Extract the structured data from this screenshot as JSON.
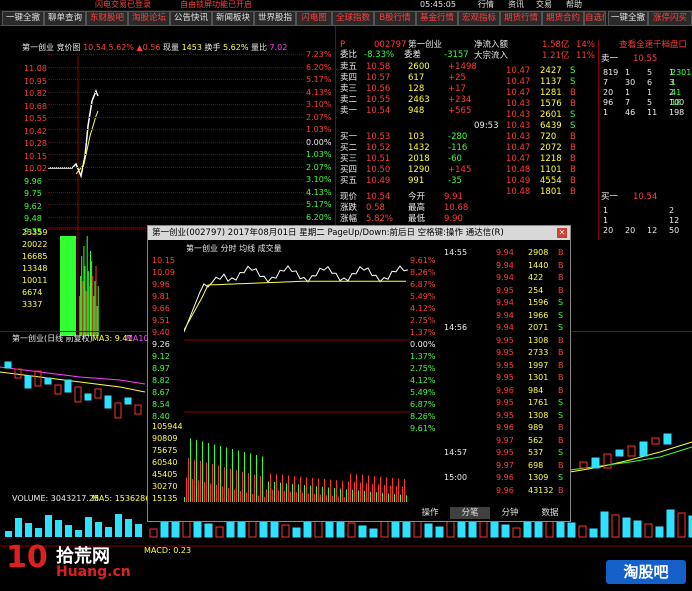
{
  "topbar": {
    "left_text": "闪电交易已登录",
    "right_text": "自由锁屏功能已开启",
    "right_menu": [
      "05:45:05",
      "行情",
      "资讯",
      "交易",
      "帮助"
    ]
  },
  "toolbar": {
    "buttons": [
      "一键全撤",
      "聊单查询",
      "东财股吧",
      "淘股论坛",
      "公告快讯",
      "新闻板块",
      "世界股指",
      "闪电图",
      "全球指数",
      "B股行情",
      "基金行情",
      "宏观指标",
      "期货行情",
      "期货合约",
      "自选信息"
    ],
    "right_buttons": [
      "一键全撤",
      "涨停闪买"
    ]
  },
  "left_panel": {
    "header": {
      "name": "第一创业",
      "mode": "竞价图",
      "price": "10.54",
      "pct": "5.62%",
      "change": "▲0.56",
      "vol_label": "现量",
      "vol": "1453",
      "turnover_label": "换手",
      "turnover": "5.62%",
      "ratio_label": "量比",
      "ratio": "7.02"
    },
    "y_left": [
      "11.08",
      "10.95",
      "10.82",
      "10.68",
      "10.55",
      "10.42",
      "10.28",
      "10.15",
      "10.02",
      "9.96",
      "9.75",
      "9.62",
      "9.48",
      "9.35"
    ],
    "y_right": [
      "7.23%",
      "6.20%",
      "5.17%",
      "4.13%",
      "3.10%",
      "2.07%",
      "1.03%",
      "0.00%",
      "1.03%",
      "2.07%",
      "3.10%",
      "4.13%",
      "5.17%",
      "6.20%",
      "7.23%"
    ],
    "vol_axis": [
      "23359",
      "20022",
      "16685",
      "13348",
      "10011",
      "6674",
      "3337"
    ]
  },
  "kline": {
    "header": "第一创业(日线 前复权)",
    "ma3": "MA3: 9.41",
    "ma10": "MA10",
    "volume": "VOLUME: 3043217.25",
    "ma5": "MA5: 1536286.38",
    "macd": "MACD: 0.23"
  },
  "quote": {
    "code": "002797",
    "name": "第一创业",
    "wei_bi_label": "委比",
    "wei_bi": "-8.33%",
    "wei_cha_label": "委差",
    "wei_cha": "-3157",
    "sell": [
      {
        "label": "卖五",
        "price": "10.58",
        "vol": "2600",
        "chg": "+1498"
      },
      {
        "label": "卖四",
        "price": "10.57",
        "vol": "617",
        "chg": "+25"
      },
      {
        "label": "卖三",
        "price": "10.56",
        "vol": "128",
        "chg": "+17"
      },
      {
        "label": "卖二",
        "price": "10.55",
        "vol": "2463",
        "chg": "+234"
      },
      {
        "label": "卖一",
        "price": "10.54",
        "vol": "948",
        "chg": "+565"
      }
    ],
    "buy": [
      {
        "label": "买一",
        "price": "10.53",
        "vol": "103",
        "chg": "-280"
      },
      {
        "label": "买二",
        "price": "10.52",
        "vol": "1432",
        "chg": "-116"
      },
      {
        "label": "买三",
        "price": "10.51",
        "vol": "2018",
        "chg": "-60"
      },
      {
        "label": "买四",
        "price": "10.50",
        "vol": "1290",
        "chg": "+145"
      },
      {
        "label": "买五",
        "price": "10.49",
        "vol": "991",
        "chg": "-35"
      }
    ],
    "stats": [
      {
        "l1": "现价",
        "v1": "10.54",
        "l2": "今开",
        "v2": "9.91"
      },
      {
        "l1": "涨跌",
        "v1": "0.58",
        "l2": "最高",
        "v2": "10.68"
      },
      {
        "l1": "涨幅",
        "v1": "5.82%",
        "l2": "最低",
        "v2": "9.90"
      }
    ]
  },
  "flow": {
    "inflow_label": "净流入额",
    "inflow": "1.58亿",
    "inflow_pct": "14%",
    "big_label": "大宗流入",
    "big": "1.21亿",
    "big_pct": "11%"
  },
  "ticks": [
    {
      "t": "",
      "p": "10.47",
      "v": "2427",
      "s": "S"
    },
    {
      "t": "",
      "p": "10.47",
      "v": "1137",
      "s": "S"
    },
    {
      "t": "",
      "p": "10.47",
      "v": "1281",
      "s": "B"
    },
    {
      "t": "",
      "p": "10.43",
      "v": "1576",
      "s": "B"
    },
    {
      "t": "",
      "p": "10.43",
      "v": "2601",
      "s": "S"
    },
    {
      "t": "09:53",
      "p": "10.43",
      "v": "6439",
      "s": "S"
    },
    {
      "t": "",
      "p": "10.43",
      "v": "720",
      "s": "B"
    },
    {
      "t": "",
      "p": "10.47",
      "v": "2072",
      "s": "B"
    },
    {
      "t": "",
      "p": "10.47",
      "v": "1218",
      "s": "B"
    },
    {
      "t": "",
      "p": "10.48",
      "v": "1101",
      "s": "B"
    },
    {
      "t": "",
      "p": "10.49",
      "v": "4554",
      "s": "B"
    },
    {
      "t": "",
      "p": "10.48",
      "v": "1801",
      "s": "B"
    }
  ],
  "far_right": {
    "button": "查看全速千档盘口",
    "sell1_label": "卖一",
    "sell1_price": "10.55",
    "sell_rows": [
      [
        "819",
        "1",
        "5",
        "1"
      ],
      [
        "7",
        "30",
        "6",
        "3"
      ],
      [
        "20",
        "1",
        "1",
        "2"
      ],
      [
        "96",
        "7",
        "5",
        "100"
      ],
      [
        "1",
        "46",
        "11",
        "198"
      ]
    ],
    "sell_extra": [
      "2301",
      "1",
      "41",
      "18"
    ],
    "buy1_label": "买一",
    "buy1_price": "10.54",
    "buy_rows": [
      [
        "1",
        "",
        "",
        "2"
      ],
      [
        "1",
        "",
        "",
        "12"
      ],
      [
        "20",
        "20",
        "12",
        "50"
      ]
    ]
  },
  "popup": {
    "title": "第一创业(002797) 2017年08月01日 星期二 PageUp/Down:前后日 空格键:操作 通达信(R)",
    "chart_title": "第一创业  分时  均线  成交量",
    "y_left": [
      "10.15",
      "10.09",
      "9.96",
      "9.81",
      "9.66",
      "9.51",
      "9.40",
      "9.26",
      "9.12",
      "8.97",
      "8.82",
      "8.67",
      "8.54",
      "8.40"
    ],
    "y_right": [
      "9.61%",
      "8.26%",
      "6.87%",
      "5.49%",
      "4.12%",
      "2.75%",
      "1.37%",
      "0.00%",
      "1.37%",
      "2.75%",
      "4.12%",
      "5.49%",
      "6.87%",
      "8.26%",
      "9.61%"
    ],
    "vol_axis": [
      "105944",
      "90809",
      "75675",
      "60540",
      "45405",
      "30270",
      "15135"
    ],
    "ticks_times": [
      "14:55",
      "14:56",
      "14:57",
      "15:00"
    ],
    "ticks": [
      {
        "p": "9.94",
        "v": "2908",
        "s": "B"
      },
      {
        "p": "9.94",
        "v": "1440",
        "s": "B"
      },
      {
        "p": "9.94",
        "v": "422",
        "s": "B"
      },
      {
        "p": "9.95",
        "v": "254",
        "s": "B"
      },
      {
        "p": "9.94",
        "v": "1596",
        "s": "S"
      },
      {
        "p": "9.94",
        "v": "1966",
        "s": "S"
      },
      {
        "p": "9.94",
        "v": "2071",
        "s": "S"
      },
      {
        "p": "9.95",
        "v": "1308",
        "s": "B"
      },
      {
        "p": "9.95",
        "v": "2733",
        "s": "B"
      },
      {
        "p": "9.95",
        "v": "1997",
        "s": "B"
      },
      {
        "p": "9.95",
        "v": "1301",
        "s": "B"
      },
      {
        "p": "9.96",
        "v": "984",
        "s": "B"
      },
      {
        "p": "9.95",
        "v": "1761",
        "s": "S"
      },
      {
        "p": "9.95",
        "v": "1308",
        "s": "S"
      },
      {
        "p": "9.96",
        "v": "989",
        "s": "B"
      },
      {
        "p": "9.97",
        "v": "562",
        "s": "B"
      },
      {
        "p": "9.95",
        "v": "537",
        "s": "S"
      },
      {
        "p": "9.97",
        "v": "698",
        "s": "B"
      },
      {
        "p": "9.96",
        "v": "1309",
        "s": "S"
      },
      {
        "p": "9.96",
        "v": "43132",
        "s": "B"
      }
    ],
    "tabs": [
      "操作",
      "分笔",
      "分钟",
      "数据"
    ]
  },
  "logo_left": {
    "digits": "10",
    "cn": "拾荒网",
    "en": "Huang.cn"
  },
  "logo_right": {
    "text": "淘股吧"
  }
}
